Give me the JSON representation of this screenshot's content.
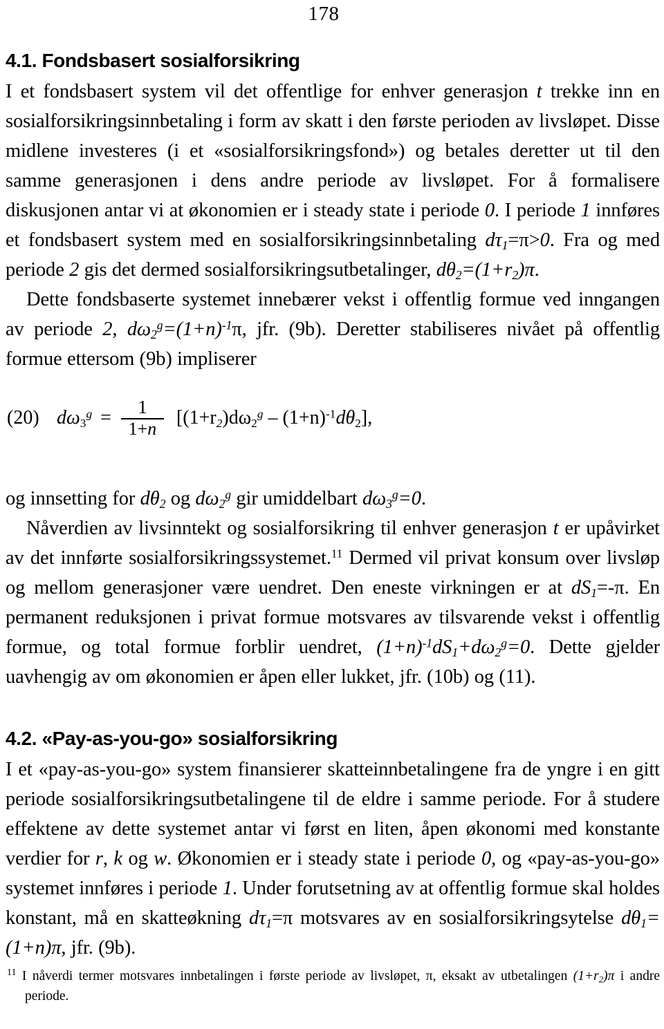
{
  "page": {
    "folio": "178",
    "background": "#ffffff",
    "text_color": "#000000"
  },
  "sections": [
    {
      "id": "fondsbasert",
      "heading": "4.1. Fondsbasert sosialforsikring",
      "paragraphs": [
        {
          "id": "p1",
          "indent": false,
          "runs": [
            {
              "t": "I et fondsbasert system vil det offentlige for enhver generasjon "
            },
            {
              "t": "t",
              "s": "i"
            },
            {
              "t": " trekke inn en sosialforsikringsinnbetaling i form av skatt i den første perioden av livsløpet. Disse midlene investeres (i et «sosialforsikringsfond») og betales deretter ut til den samme generasjonen i dens andre periode av livsløpet. For å formalisere diskusjonen antar vi at økonomien er i steady state i periode "
            },
            {
              "t": "0",
              "s": "i"
            },
            {
              "t": ". I periode "
            },
            {
              "t": "1",
              "s": "i"
            },
            {
              "t": " innføres et fondsbasert system med en sosialforsikringsinnbetaling "
            },
            {
              "t": "dτ",
              "s": "i"
            },
            {
              "t": "1",
              "s": "sub-i"
            },
            {
              "t": "=π>",
              "s": "n"
            },
            {
              "t": "0",
              "s": "i"
            },
            {
              "t": ". Fra og med periode "
            },
            {
              "t": "2",
              "s": "i"
            },
            {
              "t": " gis det dermed sosialforsikringsutbetalinger, "
            },
            {
              "t": "dθ",
              "s": "i"
            },
            {
              "t": "2",
              "s": "sub-i"
            },
            {
              "t": "=(1+r",
              "s": "i"
            },
            {
              "t": "2",
              "s": "sub-i"
            },
            {
              "t": ")π",
              "s": "i"
            },
            {
              "t": "."
            }
          ]
        },
        {
          "id": "p2",
          "indent": true,
          "runs": [
            {
              "t": "Dette fondsbaserte systemet innebærer vekst i offentlig formue ved inngangen av periode "
            },
            {
              "t": "2",
              "s": "i"
            },
            {
              "t": ", "
            },
            {
              "t": "dω",
              "s": "i"
            },
            {
              "t": "2",
              "s": "sub-i"
            },
            {
              "t": "g",
              "s": "sup-i"
            },
            {
              "t": "=(1+n)",
              "s": "i"
            },
            {
              "t": "-1",
              "s": "sup-i"
            },
            {
              "t": "π",
              "s": "n"
            },
            {
              "t": ", jfr. (9b). Deretter stabiliseres nivået på offentlig formue ettersom (9b) impliserer"
            }
          ]
        }
      ]
    }
  ],
  "equation": {
    "tag": "(20)",
    "lhs": "dω",
    "lhs_sub": "3",
    "lhs_sup": "g",
    "equals": "=",
    "fraction": {
      "numerator": "1",
      "denominator": "1+n"
    },
    "rhs_open": "[(1+r",
    "rhs_r_sub": "2",
    "rhs_mid": ")dω",
    "rhs_w_sub": "2",
    "rhs_w_sup": "g",
    "rhs_minus": " – (1+n)",
    "rhs_exp": "-1",
    "rhs_theta": "dθ",
    "rhs_theta_sub": "2",
    "rhs_close": "],"
  },
  "sections_cont": [
    {
      "id": "p3",
      "indent": false,
      "runs": [
        {
          "t": "og innsetting for "
        },
        {
          "t": "dθ",
          "s": "i"
        },
        {
          "t": "2",
          "s": "sub-i"
        },
        {
          "t": " og "
        },
        {
          "t": "dω",
          "s": "i"
        },
        {
          "t": "2",
          "s": "sub-i"
        },
        {
          "t": "g",
          "s": "sup-i"
        },
        {
          "t": " gir umiddelbart "
        },
        {
          "t": "dω",
          "s": "i"
        },
        {
          "t": "3",
          "s": "sub-i"
        },
        {
          "t": "g",
          "s": "sup-i"
        },
        {
          "t": "=0",
          "s": "i"
        },
        {
          "t": "."
        }
      ]
    },
    {
      "id": "p4",
      "indent": true,
      "runs": [
        {
          "t": "Nåverdien av livsinntekt og sosialforsikring til enhver generasjon "
        },
        {
          "t": "t",
          "s": "i"
        },
        {
          "t": " er upåvirket av det innførte sosialforsikringssystemet."
        },
        {
          "t": "11",
          "s": "fnref"
        },
        {
          "t": " Dermed vil privat konsum over livsløp og mellom generasjoner være uendret. Den eneste virkningen er at "
        },
        {
          "t": "dS",
          "s": "i"
        },
        {
          "t": "1",
          "s": "sub-i"
        },
        {
          "t": "=-π",
          "s": "n"
        },
        {
          "t": ". En permanent reduksjonen i privat formue motsvares av tilsvarende vekst i offentlig formue, og total formue forblir uendret, "
        },
        {
          "t": "(1+n)",
          "s": "i"
        },
        {
          "t": "-1",
          "s": "sup-i"
        },
        {
          "t": "dS",
          "s": "i"
        },
        {
          "t": "1",
          "s": "sub-i"
        },
        {
          "t": "+dω",
          "s": "i"
        },
        {
          "t": "2",
          "s": "sub-i"
        },
        {
          "t": "g",
          "s": "sup-i"
        },
        {
          "t": "=0",
          "s": "i"
        },
        {
          "t": ". Dette gjelder uavhengig av om økonomien er åpen eller lukket, jfr. (10b) og (11)."
        }
      ]
    }
  ],
  "section2": {
    "id": "payasyougo",
    "heading": "4.2. «Pay-as-you-go» sosialforsikring",
    "paragraph": {
      "id": "p5",
      "indent": false,
      "runs": [
        {
          "t": "I et «pay-as-you-go» system finansierer skatteinnbetalingene fra de yngre i en gitt periode sosialforsikringsutbetalingene til de eldre i samme periode. For å studere effektene av dette systemet antar vi først en liten, åpen økonomi med konstante verdier for "
        },
        {
          "t": "r",
          "s": "i"
        },
        {
          "t": ", "
        },
        {
          "t": "k",
          "s": "i"
        },
        {
          "t": " og "
        },
        {
          "t": "w",
          "s": "i"
        },
        {
          "t": ". Økonomien er i steady state i periode "
        },
        {
          "t": "0",
          "s": "i"
        },
        {
          "t": ", og «pay-as-you-go» systemet innføres i periode "
        },
        {
          "t": "1",
          "s": "i"
        },
        {
          "t": ". Under forutsetning av at offentlig formue skal holdes konstant, må en skatteøkning "
        },
        {
          "t": "dτ",
          "s": "i"
        },
        {
          "t": "1",
          "s": "sub-i"
        },
        {
          "t": "=π",
          "s": "n"
        },
        {
          "t": " motsvares av en sosialforsikringsytelse "
        },
        {
          "t": "dθ",
          "s": "i"
        },
        {
          "t": "1",
          "s": "sub-i"
        },
        {
          "t": "=(1+n)π",
          "s": "i"
        },
        {
          "t": ", jfr. (9b)."
        }
      ]
    }
  },
  "footnote": {
    "marker": "11",
    "runs": [
      {
        "t": " I nåverdi termer motsvares innbetalingen i første periode av livsløpet, π, eksakt av utbetalingen "
      },
      {
        "t": "(1+r",
        "s": "i"
      },
      {
        "t": "2",
        "s": "sub-i"
      },
      {
        "t": ")π",
        "s": "i"
      },
      {
        "t": " i andre periode."
      }
    ]
  }
}
